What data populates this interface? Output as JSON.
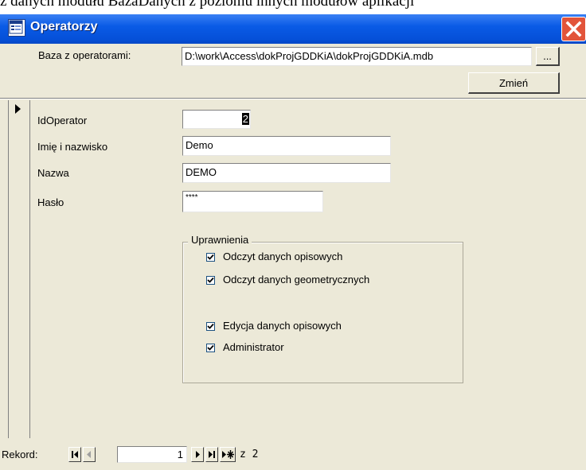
{
  "document_caption": "z danych modułu BazaDanych z poziomu innych modułów aplikacji",
  "window": {
    "title": "Operatorzy"
  },
  "header": {
    "db_label": "Baza z operatorami:",
    "db_path": "D:\\work\\Access\\dokProjGDDKiA\\dokProjGDDKiA.mdb",
    "browse_label": "...",
    "change_label": "Zmień"
  },
  "form": {
    "id_label": "IdOperator",
    "id_value": "2",
    "name_label": "Imię i nazwisko",
    "name_value": "Demo",
    "login_label": "Nazwa",
    "login_value": "DEMO",
    "password_label": "Hasło",
    "password_value": "****"
  },
  "permissions": {
    "title": "Uprawnienia",
    "items": [
      {
        "label": "Odczyt danych opisowych",
        "checked": true
      },
      {
        "label": "Odczyt danych geometrycznych",
        "checked": true
      },
      {
        "label": "Edycja danych opisowych",
        "checked": true
      },
      {
        "label": "Administrator",
        "checked": true
      }
    ]
  },
  "navigation": {
    "record_label": "Rekord:",
    "current_record": "1",
    "total_text": "z 2"
  },
  "icons": {
    "title": "form-icon",
    "close": "close-icon",
    "first": "first-record-icon",
    "prev": "previous-record-icon",
    "next": "next-record-icon",
    "last": "last-record-icon",
    "new": "new-record-icon",
    "selector": "record-selector-arrow-icon"
  }
}
